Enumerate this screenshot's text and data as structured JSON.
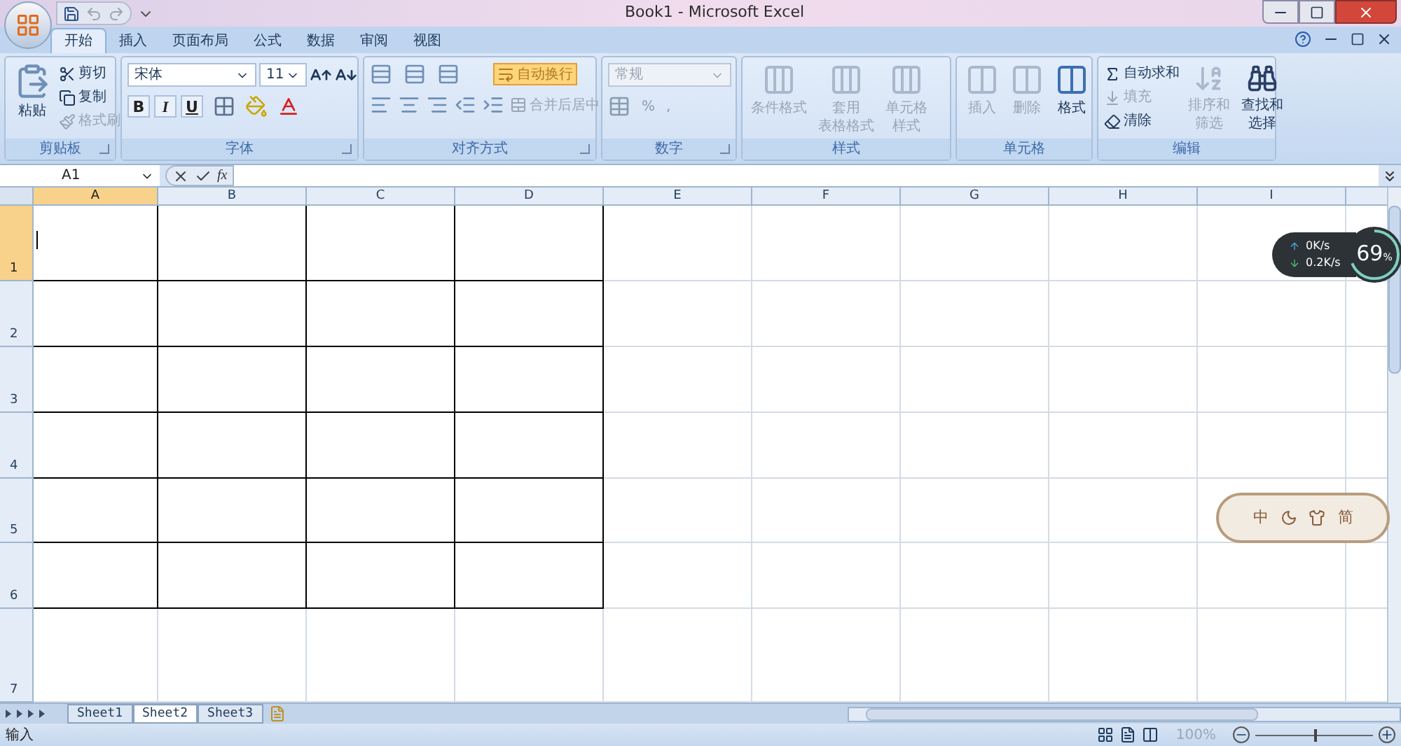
{
  "window": {
    "title": "Book1 - Microsoft Excel"
  },
  "ribbon_tabs": [
    {
      "label": "开始",
      "selected": true
    },
    {
      "label": "插入",
      "selected": false
    },
    {
      "label": "页面布局",
      "selected": false
    },
    {
      "label": "公式",
      "selected": false
    },
    {
      "label": "数据",
      "selected": false
    },
    {
      "label": "审阅",
      "selected": false
    },
    {
      "label": "视图",
      "selected": false
    }
  ],
  "clipboard": {
    "label": "剪贴板",
    "paste": "粘贴",
    "items": [
      {
        "label": "剪切",
        "disabled": false
      },
      {
        "label": "复制",
        "disabled": false
      },
      {
        "label": "格式刷",
        "disabled": true
      }
    ]
  },
  "font": {
    "label": "字体",
    "font_name": "宋体",
    "font_size": "11",
    "style_buttons": [
      "B",
      "I",
      "U"
    ]
  },
  "alignment": {
    "label": "对齐方式",
    "wrap": {
      "label": "自动换行",
      "active": true
    },
    "merge": {
      "label": "合并后居中",
      "disabled": true
    }
  },
  "number": {
    "label": "数字",
    "format": {
      "value": "常规",
      "disabled": true
    },
    "percent": "%",
    "comma": ","
  },
  "styles": {
    "label": "样式",
    "buttons": [
      {
        "lines": [
          "条件格式"
        ],
        "disabled": true
      },
      {
        "lines": [
          "套用",
          "表格格式"
        ],
        "disabled": true
      },
      {
        "lines": [
          "单元格",
          "样式"
        ],
        "disabled": true
      }
    ]
  },
  "cells_group": {
    "label": "单元格",
    "buttons": [
      {
        "label": "插入",
        "disabled": true
      },
      {
        "label": "删除",
        "disabled": true
      },
      {
        "label": "格式",
        "disabled": false
      }
    ]
  },
  "editing": {
    "label": "编辑",
    "small": [
      {
        "kind": "sum",
        "label": "自动求和",
        "disabled": false
      },
      {
        "kind": "fill",
        "label": "填充",
        "disabled": true
      },
      {
        "kind": "clear",
        "label": "清除",
        "disabled": false
      }
    ],
    "large": [
      {
        "kind": "sort",
        "lines": [
          "排序和",
          "筛选"
        ],
        "disabled": true
      },
      {
        "kind": "find",
        "lines": [
          "查找和",
          "选择"
        ],
        "disabled": false
      }
    ]
  },
  "formula_bar": {
    "name_box": "A1",
    "fx": "fx"
  },
  "columns": [
    {
      "label": "A",
      "selected": true,
      "bordered": true
    },
    {
      "label": "B",
      "selected": false,
      "bordered": true
    },
    {
      "label": "C",
      "selected": false,
      "bordered": true
    },
    {
      "label": "D",
      "selected": false,
      "bordered": true
    },
    {
      "label": "E",
      "selected": false,
      "bordered": false
    },
    {
      "label": "F",
      "selected": false,
      "bordered": false
    },
    {
      "label": "G",
      "selected": false,
      "bordered": false
    },
    {
      "label": "H",
      "selected": false,
      "bordered": false
    },
    {
      "label": "I",
      "selected": false,
      "bordered": false
    }
  ],
  "rows": [
    {
      "label": "1",
      "selected": true,
      "bordered": true
    },
    {
      "label": "2",
      "selected": false,
      "bordered": true
    },
    {
      "label": "3",
      "selected": false,
      "bordered": true
    },
    {
      "label": "4",
      "selected": false,
      "bordered": true
    },
    {
      "label": "5",
      "selected": false,
      "bordered": true
    },
    {
      "label": "6",
      "selected": false,
      "bordered": true
    },
    {
      "label": "7",
      "selected": false,
      "bordered": false
    }
  ],
  "sheet_tabs": [
    {
      "label": "Sheet1",
      "selected": false
    },
    {
      "label": "Sheet2",
      "selected": true
    },
    {
      "label": "Sheet3",
      "selected": false
    }
  ],
  "status_bar": {
    "mode": "输入",
    "zoom": "100%",
    "zoom_slider": {
      "level": 0.5
    }
  },
  "network_widget": {
    "upload": "0K/s",
    "download": "0.2K/s",
    "percent": "69",
    "unit": "%"
  },
  "ime_bar": {
    "items": [
      "中",
      "简"
    ]
  }
}
